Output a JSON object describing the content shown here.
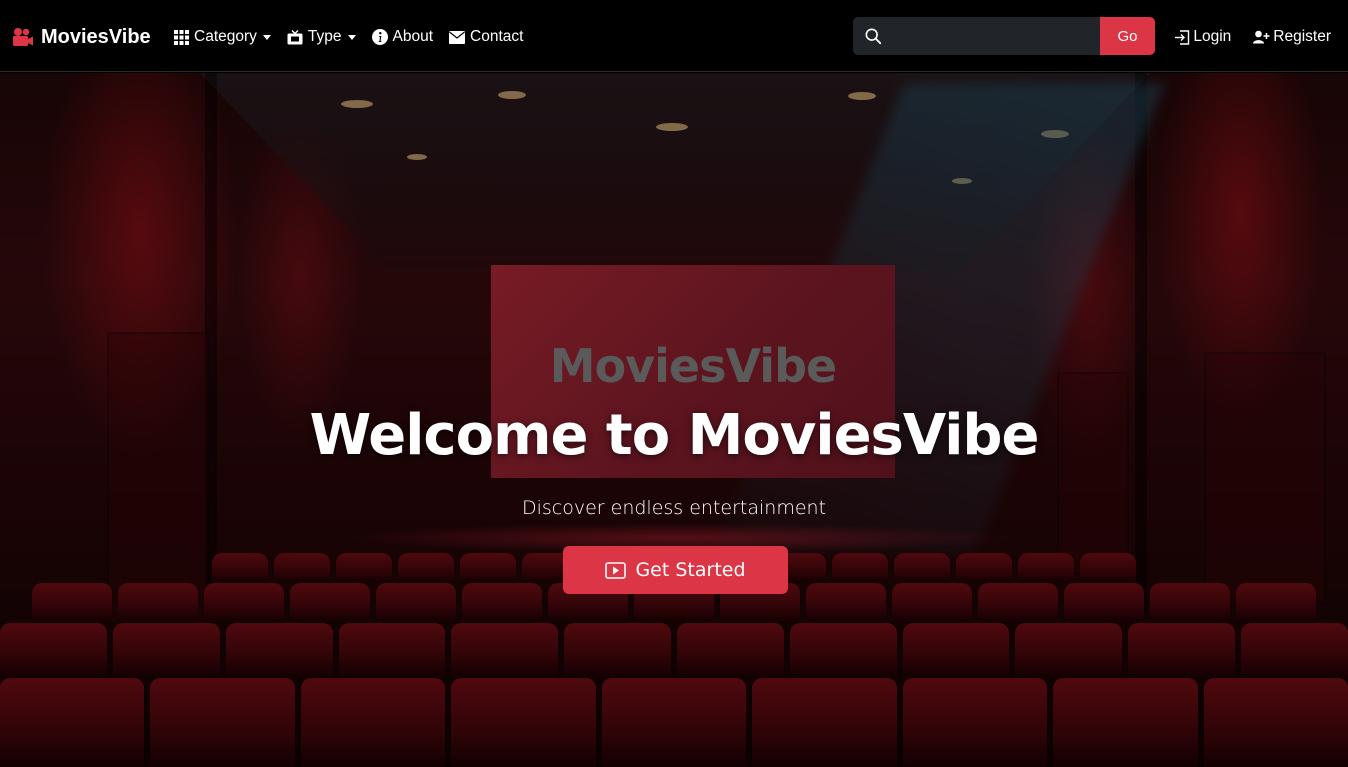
{
  "brand": {
    "name": "MoviesVibe"
  },
  "nav": {
    "category": "Category",
    "type": "Type",
    "about": "About",
    "contact": "Contact"
  },
  "search": {
    "placeholder": "",
    "button": "Go"
  },
  "auth": {
    "login": "Login",
    "register": "Register"
  },
  "hero": {
    "screen_text": "MoviesVibe",
    "title": "Welcome to MoviesVibe",
    "subtitle": "Discover endless entertainment",
    "cta": "Get Started"
  },
  "colors": {
    "accent": "#dc3545",
    "navbar": "#000000",
    "search_bg": "#212529"
  },
  "icons": {
    "brand": "camera-reels-icon",
    "category": "grid-icon",
    "type": "tv-icon",
    "about": "info-circle-icon",
    "contact": "envelope-icon",
    "search": "search-icon",
    "login": "login-icon",
    "register": "person-plus-icon",
    "cta": "play-icon"
  }
}
